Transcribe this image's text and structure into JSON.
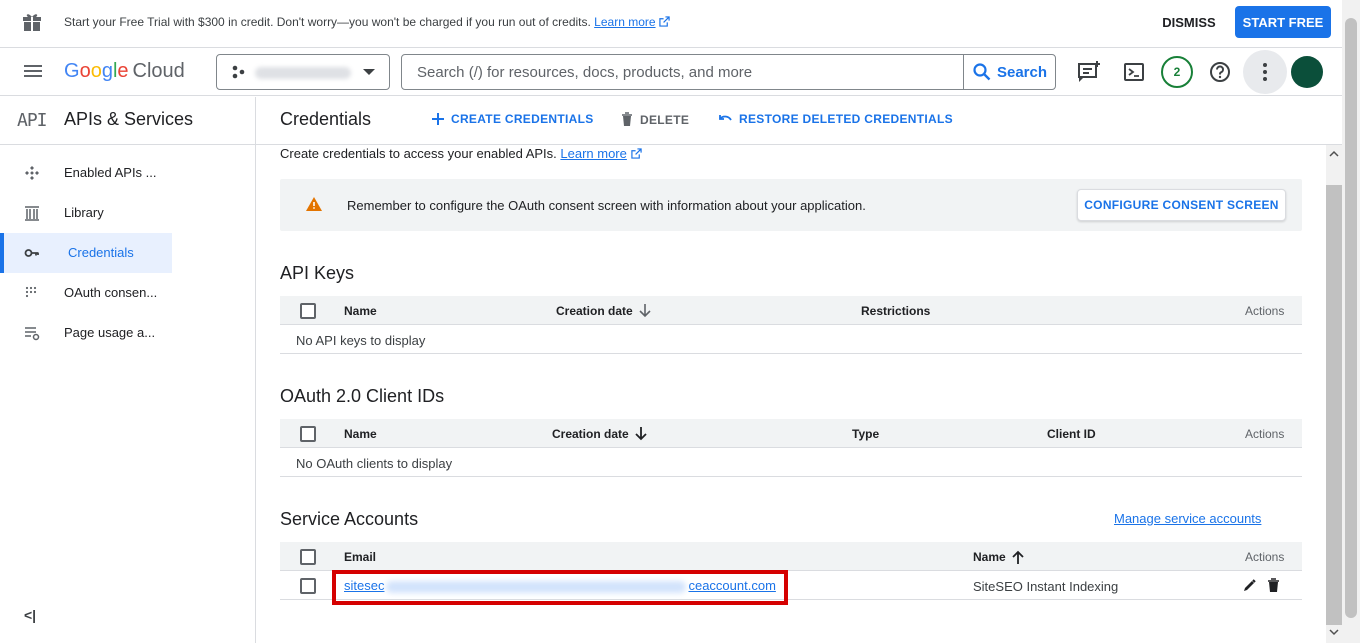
{
  "promo": {
    "message": "Start your Free Trial with $300 in credit. Don't worry—you won't be charged if you run out of credits.",
    "learn_more": "Learn more",
    "dismiss": "DISMISS",
    "start_free": "START FREE"
  },
  "header": {
    "logo_google": [
      "G",
      "o",
      "o",
      "g",
      "l",
      "e"
    ],
    "logo_cloud": "Cloud",
    "search_placeholder": "Search (/) for resources, docs, products, and more",
    "search_button": "Search",
    "notifications_count": "2",
    "colors": {
      "accent": "#1a73e8",
      "notification": "#188038"
    }
  },
  "sidebar": {
    "api_badge": "API",
    "title": "APIs & Services",
    "items": [
      {
        "label": "Enabled APIs ...",
        "icon": "enabled-apis-icon"
      },
      {
        "label": "Library",
        "icon": "library-icon"
      },
      {
        "label": "Credentials",
        "icon": "key-icon",
        "active": true
      },
      {
        "label": "OAuth consen...",
        "icon": "oauth-consent-icon"
      },
      {
        "label": "Page usage a...",
        "icon": "page-usage-icon"
      }
    ],
    "collapse": "<|"
  },
  "main": {
    "title": "Credentials",
    "actions": {
      "create": "CREATE CREDENTIALS",
      "delete": "DELETE",
      "restore": "RESTORE DELETED CREDENTIALS"
    },
    "intro": "Create credentials to access your enabled APIs.",
    "intro_link": "Learn more",
    "notice": "Remember to configure the OAuth consent screen with information about your application.",
    "notice_button": "CONFIGURE CONSENT SCREEN",
    "api_keys": {
      "title": "API Keys",
      "columns": [
        "Name",
        "Creation date",
        "Restrictions",
        "Actions"
      ],
      "empty": "No API keys to display"
    },
    "oauth": {
      "title": "OAuth 2.0 Client IDs",
      "columns": [
        "Name",
        "Creation date",
        "Type",
        "Client ID",
        "Actions"
      ],
      "empty": "No OAuth clients to display"
    },
    "service_accounts": {
      "title": "Service Accounts",
      "manage_link": "Manage service accounts",
      "columns": [
        "Email",
        "Name",
        "Actions"
      ],
      "rows": [
        {
          "email_start": "sitesec",
          "email_end": "ceaccount.com",
          "name": "SiteSEO Instant Indexing"
        }
      ]
    }
  }
}
